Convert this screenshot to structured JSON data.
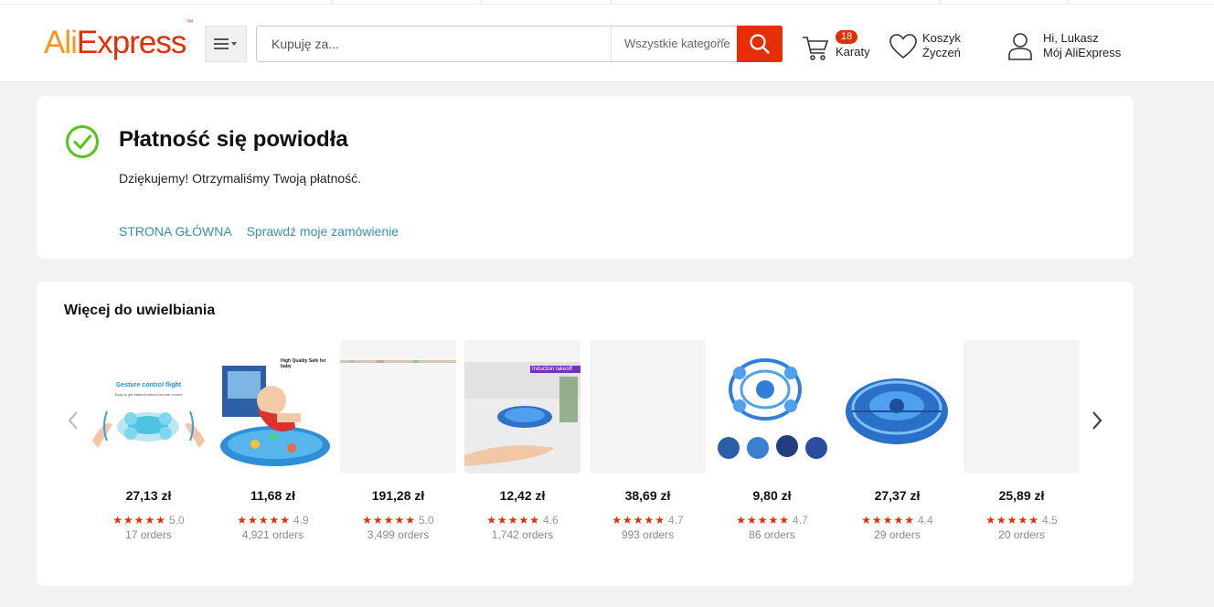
{
  "header": {
    "logo": {
      "part1": "Ali",
      "part2": "Express",
      "tm": "™"
    },
    "search": {
      "placeholder": "Kupuję za...",
      "category": "Wszystkie kategorie"
    },
    "cart": {
      "count": "18",
      "label": "Karaty"
    },
    "wishlist": {
      "line1": "Koszyk",
      "line2": "Życzeń"
    },
    "account": {
      "line1": "Hi, Lukasz",
      "line2": "Mój AliExpress"
    }
  },
  "success": {
    "title": "Płatność się powiodła",
    "message": "Dziękujemy! Otrzymaliśmy Twoją płatność.",
    "link_home": "STRONA GŁÓWNA",
    "link_orders": "Sprawdź moje zamówienie"
  },
  "recommendations": {
    "title": "Więcej do uwielbiania",
    "stars": "★★★★★",
    "items": [
      {
        "price": "27,13 zł",
        "rating": "5.0",
        "orders": "17 orders"
      },
      {
        "price": "11,68 zł",
        "rating": "4.9",
        "orders": "4,921 orders"
      },
      {
        "price": "191,28 zł",
        "rating": "5.0",
        "orders": "3,499 orders"
      },
      {
        "price": "12,42 zł",
        "rating": "4.6",
        "orders": "1,742 orders"
      },
      {
        "price": "38,69 zł",
        "rating": "4.7",
        "orders": "993 orders"
      },
      {
        "price": "9,80 zł",
        "rating": "4.7",
        "orders": "86 orders"
      },
      {
        "price": "27,37 zł",
        "rating": "4.4",
        "orders": "29 orders"
      },
      {
        "price": "25,89 zł",
        "rating": "4.5",
        "orders": "20 orders"
      }
    ],
    "image_captions": {
      "gesture": "Gesture control flight",
      "gesture_sub": "Easy to get started without remote control",
      "induction": "Induction takeoff",
      "mat": "High Quality Safe for baby"
    }
  },
  "colors": {
    "brand": "#e62e04",
    "accent_orange": "#f7971d",
    "link": "#3a8fb7",
    "success": "#52c41a"
  }
}
